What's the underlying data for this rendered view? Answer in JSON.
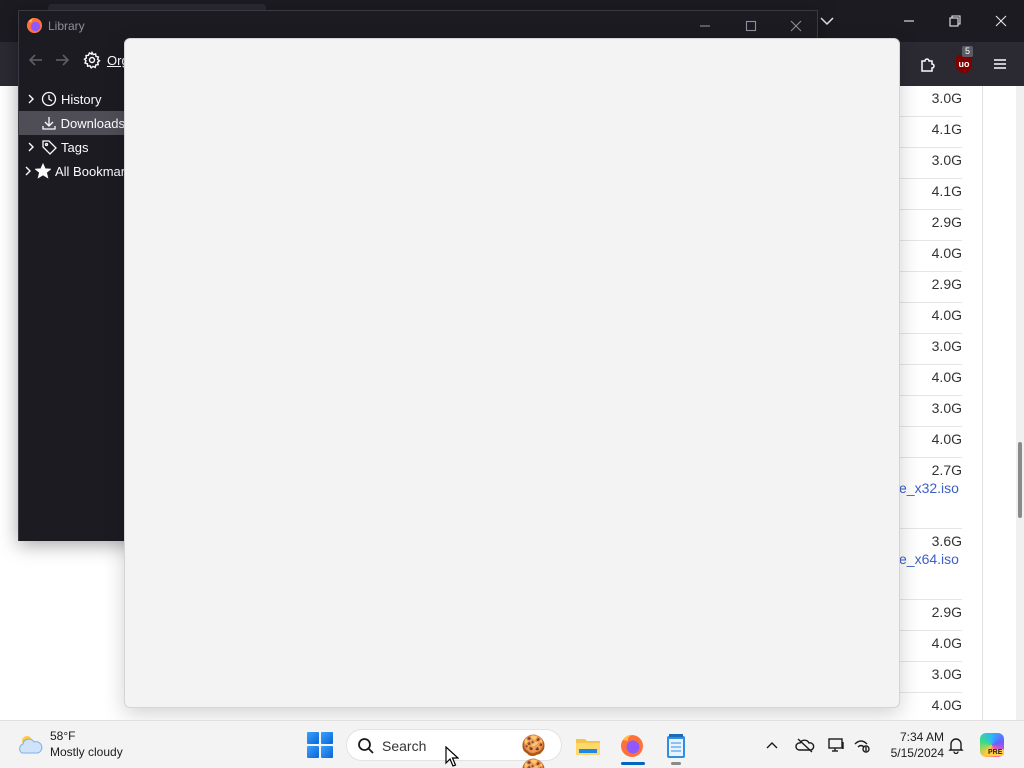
{
  "firefox": {
    "ublock_count": "5"
  },
  "listing": {
    "sizes": [
      "3.0G",
      "4.1G",
      "3.0G",
      "4.1G",
      "2.9G",
      "4.0G",
      "2.9G",
      "4.0G",
      "3.0G",
      "4.0G",
      "3.0G",
      "4.0G",
      "2.7G",
      "3.6G",
      "2.9G",
      "4.0G",
      "3.0G",
      "4.0G"
    ],
    "links": [
      "e_x32.iso",
      "e_x64.iso"
    ]
  },
  "library": {
    "title": "Library",
    "organize_label": "Org",
    "tree": [
      {
        "label": "History",
        "icon": "clock-icon",
        "expandable": true,
        "selected": false
      },
      {
        "label": "Downloads",
        "icon": "download-icon",
        "expandable": false,
        "selected": true
      },
      {
        "label": "Tags",
        "icon": "tag-icon",
        "expandable": true,
        "selected": false
      },
      {
        "label": "All Bookmar",
        "icon": "star-icon",
        "expandable": true,
        "selected": false
      }
    ]
  },
  "taskbar": {
    "weather": {
      "temp": "58°F",
      "desc": "Mostly cloudy"
    },
    "search_placeholder": "Search",
    "clock": {
      "time": "7:34 AM",
      "date": "5/15/2024"
    },
    "copilot_badge": "PRE"
  },
  "colors": {
    "accent": "#0067c0",
    "link": "#3c5fc7",
    "ff_dark": "#1c1b22",
    "dialog_bg": "#f3f3f3"
  }
}
